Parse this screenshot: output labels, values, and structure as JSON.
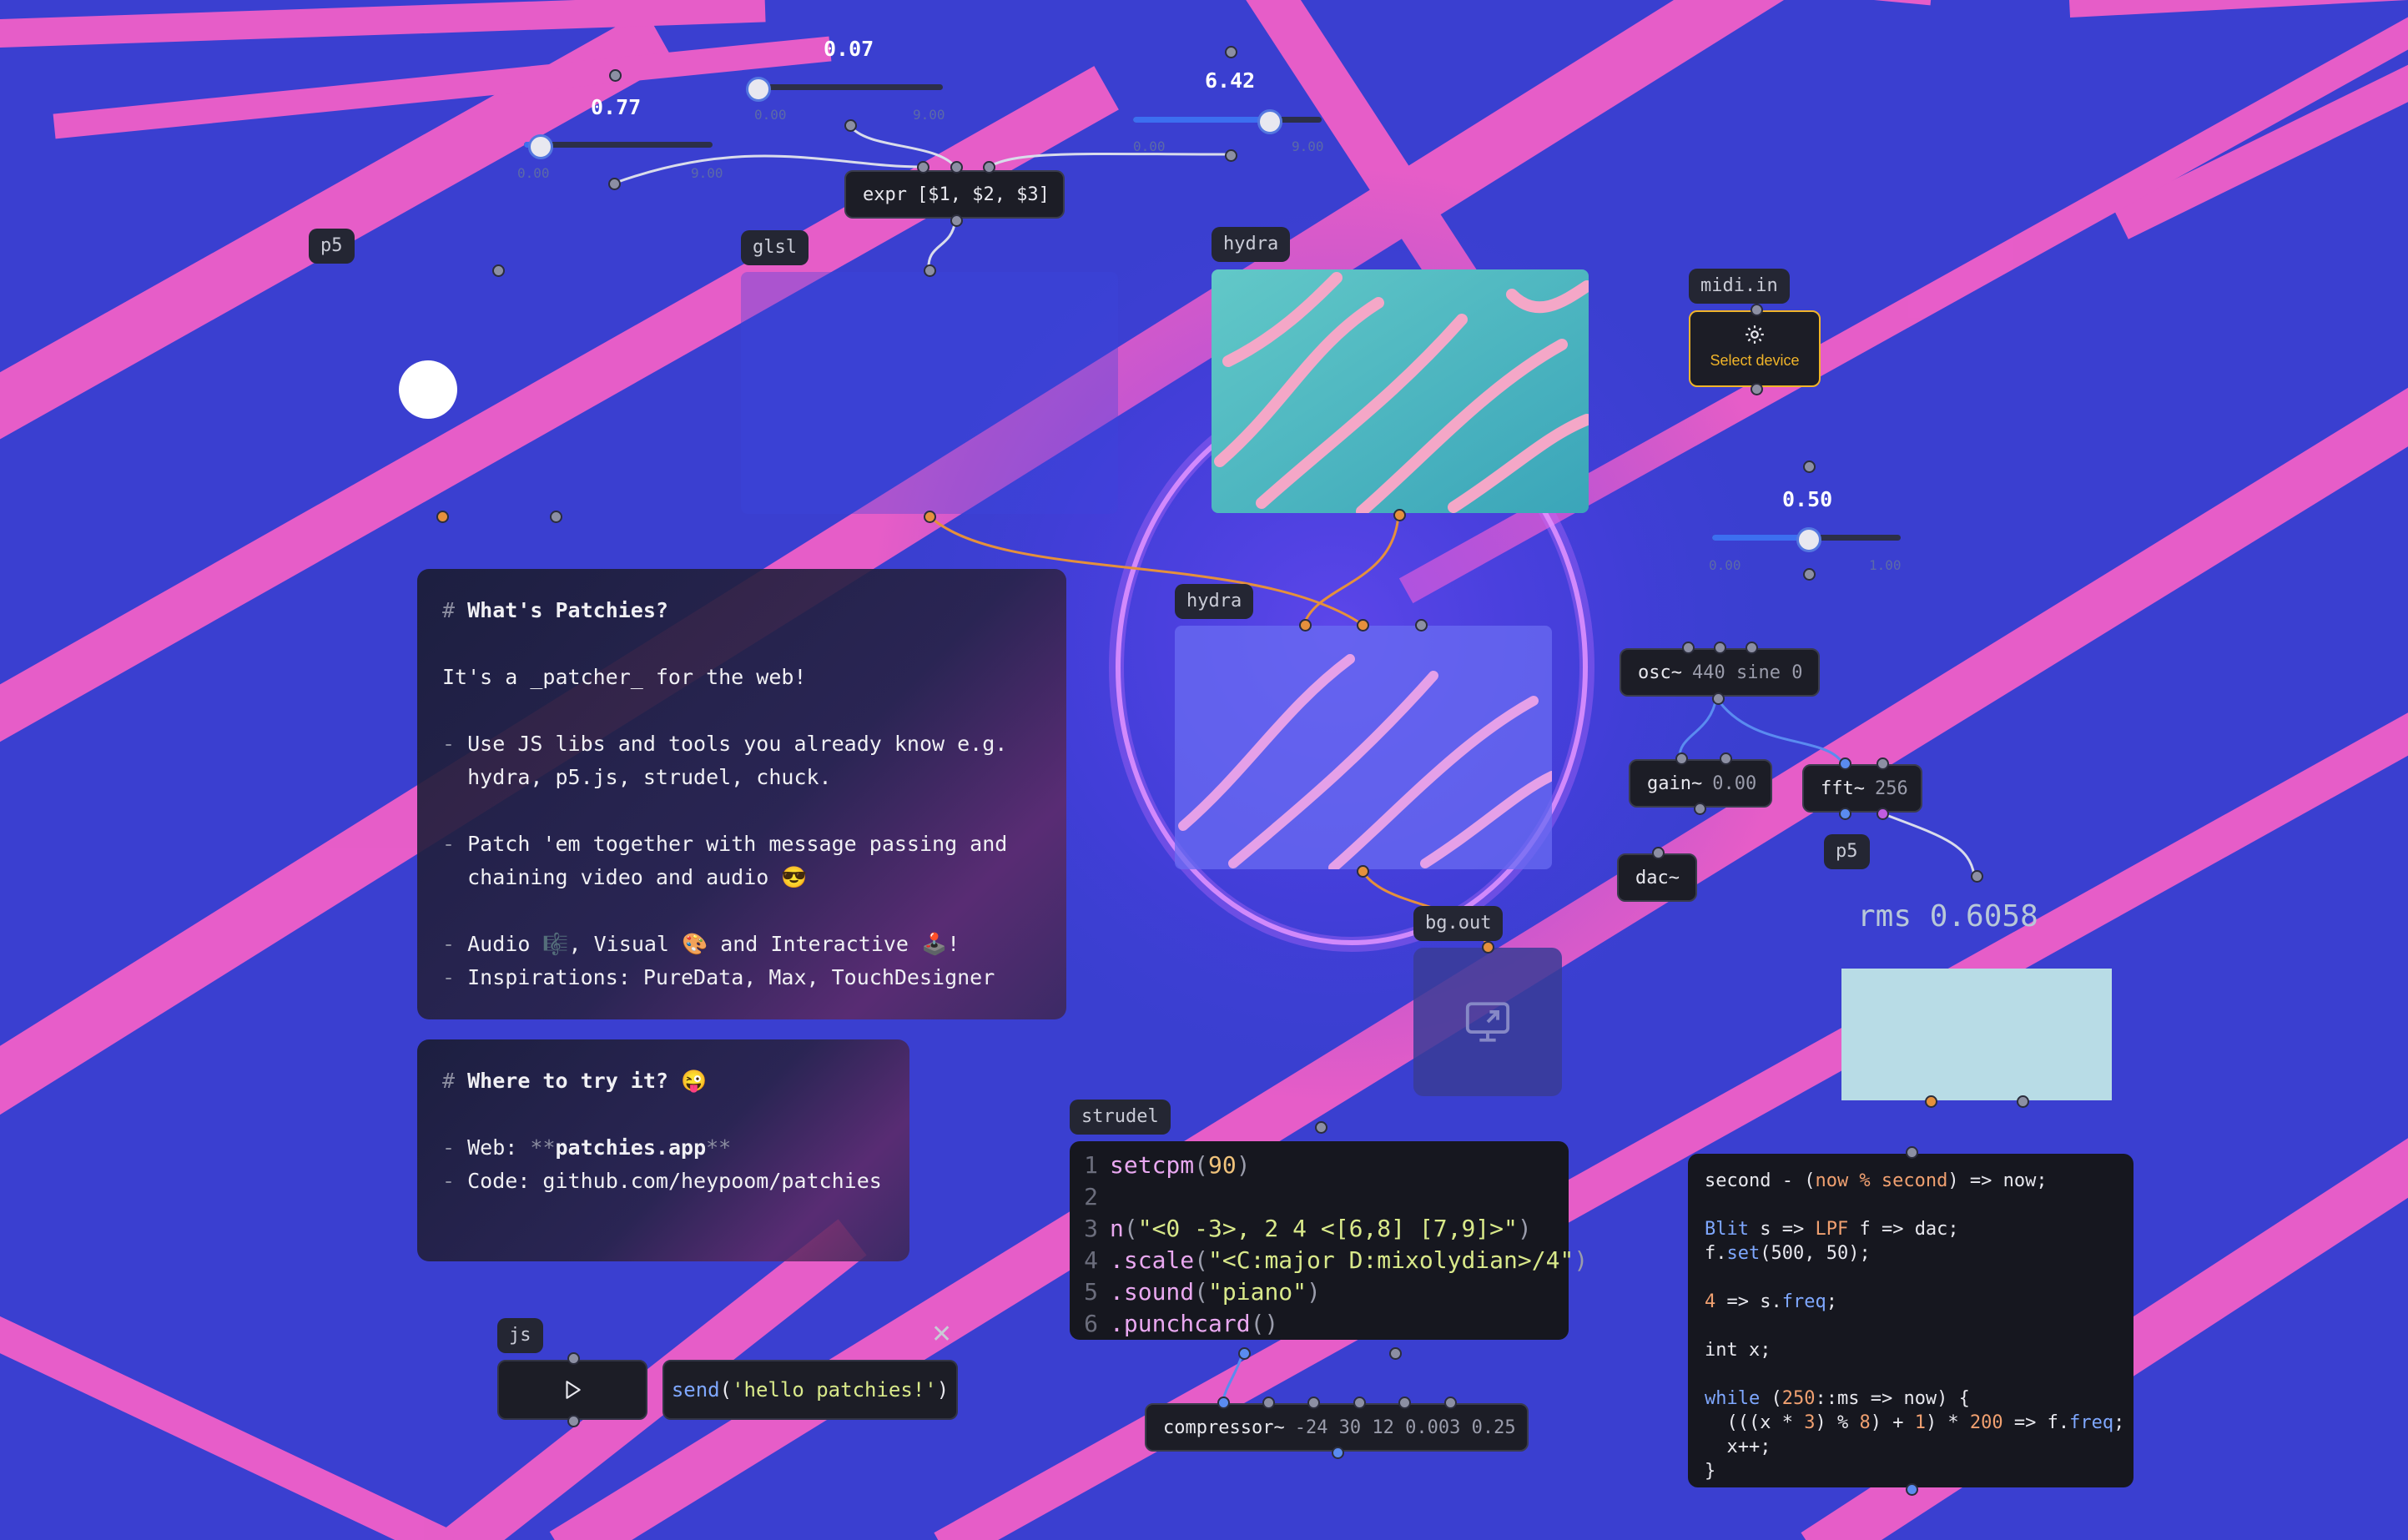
{
  "colors": {
    "background": "#3a3fd0",
    "stripe": "#f05fc8",
    "accent": "#3c6ff0",
    "midi": "#f0b429"
  },
  "sliders": [
    {
      "value": "0.77",
      "min": "0.00",
      "max": "9.00",
      "level": 0.077
    },
    {
      "value": "0.07",
      "min": "0.00",
      "max": "9.00",
      "level": 0.008
    },
    {
      "value": "6.42",
      "min": "0.00",
      "max": "9.00",
      "level": 0.713
    },
    {
      "value": "0.50",
      "min": "0.00",
      "max": "1.00",
      "level": 0.5
    }
  ],
  "nodes": {
    "expr": {
      "name": "expr",
      "args": "[$1, $2, $3]"
    },
    "p5_top": "p5",
    "glsl": "glsl",
    "hydra_top": "hydra",
    "hydra_mid": "hydra",
    "midi": {
      "title": "midi.in",
      "button": "Select device",
      "icon": "gear-icon"
    },
    "osc": {
      "name": "osc~",
      "args": "440 sine 0"
    },
    "gain": {
      "name": "gain~",
      "args": "0.00"
    },
    "fft": {
      "name": "fft~",
      "args": "256"
    },
    "p5_small": "p5",
    "dac": "dac~",
    "bg_out": {
      "title": "bg.out",
      "icon": "monitor-icon"
    },
    "rms": "rms 0.6058",
    "strudel": "strudel",
    "compressor": {
      "name": "compressor~",
      "args": "-24 30 12 0.003 0.25"
    },
    "js": {
      "title": "js",
      "play_icon": "play-icon",
      "close_icon": "close-icon",
      "code_fn": "send",
      "code_str": "'hello patchies!'"
    }
  },
  "intro": {
    "hash": "#",
    "title": "What's Patchies?",
    "line1": "It's a _patcher_ for the web!",
    "dash": "-",
    "b1a": "Use JS libs and tools you already know e.g.",
    "b1b": "hydra, p5.js, strudel, chuck.",
    "b2a": "Patch 'em together with message passing and",
    "b2b": "chaining video and audio 😎",
    "b3": "Audio 🎼, Visual 🎨 and Interactive 🕹️!",
    "b4": "Inspirations: PureData, Max, TouchDesigner"
  },
  "try": {
    "hash": "#",
    "title": "Where to try it? 😜",
    "dash": "-",
    "web_label": "Web: ",
    "web_mark": "**",
    "web_value": "patchies.app",
    "code_line": "Code: github.com/heypoom/patchies"
  },
  "strudel_code": {
    "lines": [
      {
        "n": "1",
        "parts": [
          [
            "setcpm",
            "#e9a8f0"
          ],
          [
            "(",
            "#9a9cab"
          ],
          [
            "90",
            "#f0c27a"
          ],
          [
            ")",
            "#9a9cab"
          ]
        ]
      },
      {
        "n": "2",
        "parts": []
      },
      {
        "n": "3",
        "parts": [
          [
            "n",
            "#e9a8f0"
          ],
          [
            "(",
            "#9a9cab"
          ],
          [
            "\"<0 -3>, 2 4 <[6,8] [7,9]>\"",
            "#d9e98a"
          ],
          [
            ")",
            "#9a9cab"
          ]
        ]
      },
      {
        "n": "4",
        "parts": [
          [
            ".scale",
            "#e9a8f0"
          ],
          [
            "(",
            "#9a9cab"
          ],
          [
            "\"<C:major D:mixolydian>/4\"",
            "#d9e98a"
          ],
          [
            ")",
            "#9a9cab"
          ]
        ]
      },
      {
        "n": "5",
        "parts": [
          [
            ".sound",
            "#e9a8f0"
          ],
          [
            "(",
            "#9a9cab"
          ],
          [
            "\"piano\"",
            "#d9e98a"
          ],
          [
            ")",
            "#9a9cab"
          ]
        ]
      },
      {
        "n": "6",
        "parts": [
          [
            ".punchcard",
            "#e9a8f0"
          ],
          [
            "()",
            "#9a9cab"
          ]
        ]
      }
    ]
  },
  "chuck_code": {
    "lines": [
      [
        [
          "second - (",
          "#e8e8ee"
        ],
        [
          "now % second",
          "#f0a070"
        ],
        [
          ") => now;",
          "#e8e8ee"
        ]
      ],
      [],
      [
        [
          "Blit",
          "#7fa8ff"
        ],
        [
          " s => ",
          "#e8e8ee"
        ],
        [
          "LPF",
          "#f0a070"
        ],
        [
          " f => dac;",
          "#e8e8ee"
        ]
      ],
      [
        [
          "f.",
          "#e8e8ee"
        ],
        [
          "set",
          "#7fa8ff"
        ],
        [
          "(500, 50);",
          "#e8e8ee"
        ]
      ],
      [],
      [
        [
          "4",
          "#f0a070"
        ],
        [
          " => s.",
          "#e8e8ee"
        ],
        [
          "freq",
          "#7fa8ff"
        ],
        [
          ";",
          "#e8e8ee"
        ]
      ],
      [],
      [
        [
          "int x;",
          "#e8e8ee"
        ]
      ],
      [],
      [
        [
          "while",
          "#7fa8ff"
        ],
        [
          " (",
          "#e8e8ee"
        ],
        [
          "250",
          "#f0a070"
        ],
        [
          "::ms => now) {",
          "#e8e8ee"
        ]
      ],
      [
        [
          "  (((x * ",
          "#e8e8ee"
        ],
        [
          "3",
          "#f0a070"
        ],
        [
          ") % ",
          "#e8e8ee"
        ],
        [
          "8",
          "#f0a070"
        ],
        [
          ") + ",
          "#e8e8ee"
        ],
        [
          "1",
          "#f0a070"
        ],
        [
          ") * ",
          "#e8e8ee"
        ],
        [
          "200",
          "#f0a070"
        ],
        [
          " => f.",
          "#e8e8ee"
        ],
        [
          "freq",
          "#7fa8ff"
        ],
        [
          ";",
          "#e8e8ee"
        ]
      ],
      [
        [
          "  x++;",
          "#e8e8ee"
        ]
      ],
      [
        [
          "}",
          "#e8e8ee"
        ]
      ]
    ]
  }
}
